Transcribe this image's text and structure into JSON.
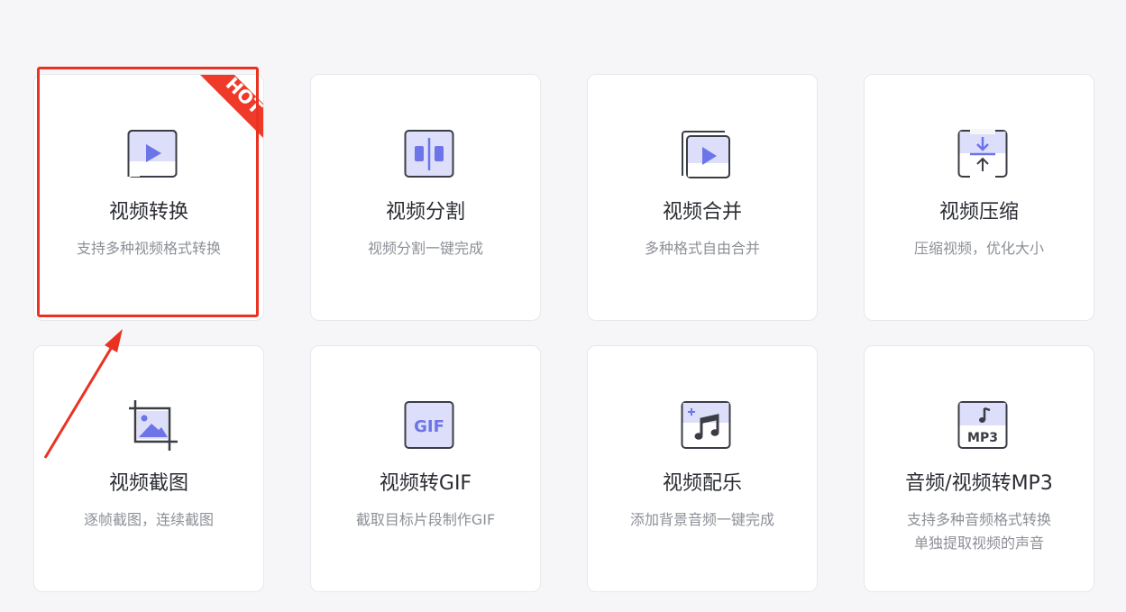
{
  "colors": {
    "background": "#f6f6f8",
    "card": "#ffffff",
    "accent": "#6c74e8",
    "accent_light": "#dcdefa",
    "icon_stroke": "#3b3d44",
    "highlight": "#ea3222",
    "hot_badge": "#ef3a2a"
  },
  "hot_badge": {
    "text": "HOT"
  },
  "cards": [
    {
      "title": "视频转换",
      "desc": "支持多种视频格式转换",
      "icon": "video-convert-icon",
      "hot": true
    },
    {
      "title": "视频分割",
      "desc": "视频分割一键完成",
      "icon": "video-split-icon"
    },
    {
      "title": "视频合并",
      "desc": "多种格式自由合并",
      "icon": "video-merge-icon"
    },
    {
      "title": "视频压缩",
      "desc": "压缩视频，优化大小",
      "icon": "video-compress-icon"
    },
    {
      "title": "视频截图",
      "desc": "逐帧截图，连续截图",
      "icon": "video-screenshot-icon"
    },
    {
      "title": "视频转GIF",
      "desc": "截取目标片段制作GIF",
      "icon": "gif-icon",
      "icon_text": "GIF"
    },
    {
      "title": "视频配乐",
      "desc": "添加背景音频一键完成",
      "icon": "music-note-icon"
    },
    {
      "title": "音频/视频转MP3",
      "desc": "支持多种音频格式转换",
      "desc2": "单独提取视频的声音",
      "icon": "mp3-icon",
      "icon_text": "MP3"
    }
  ]
}
